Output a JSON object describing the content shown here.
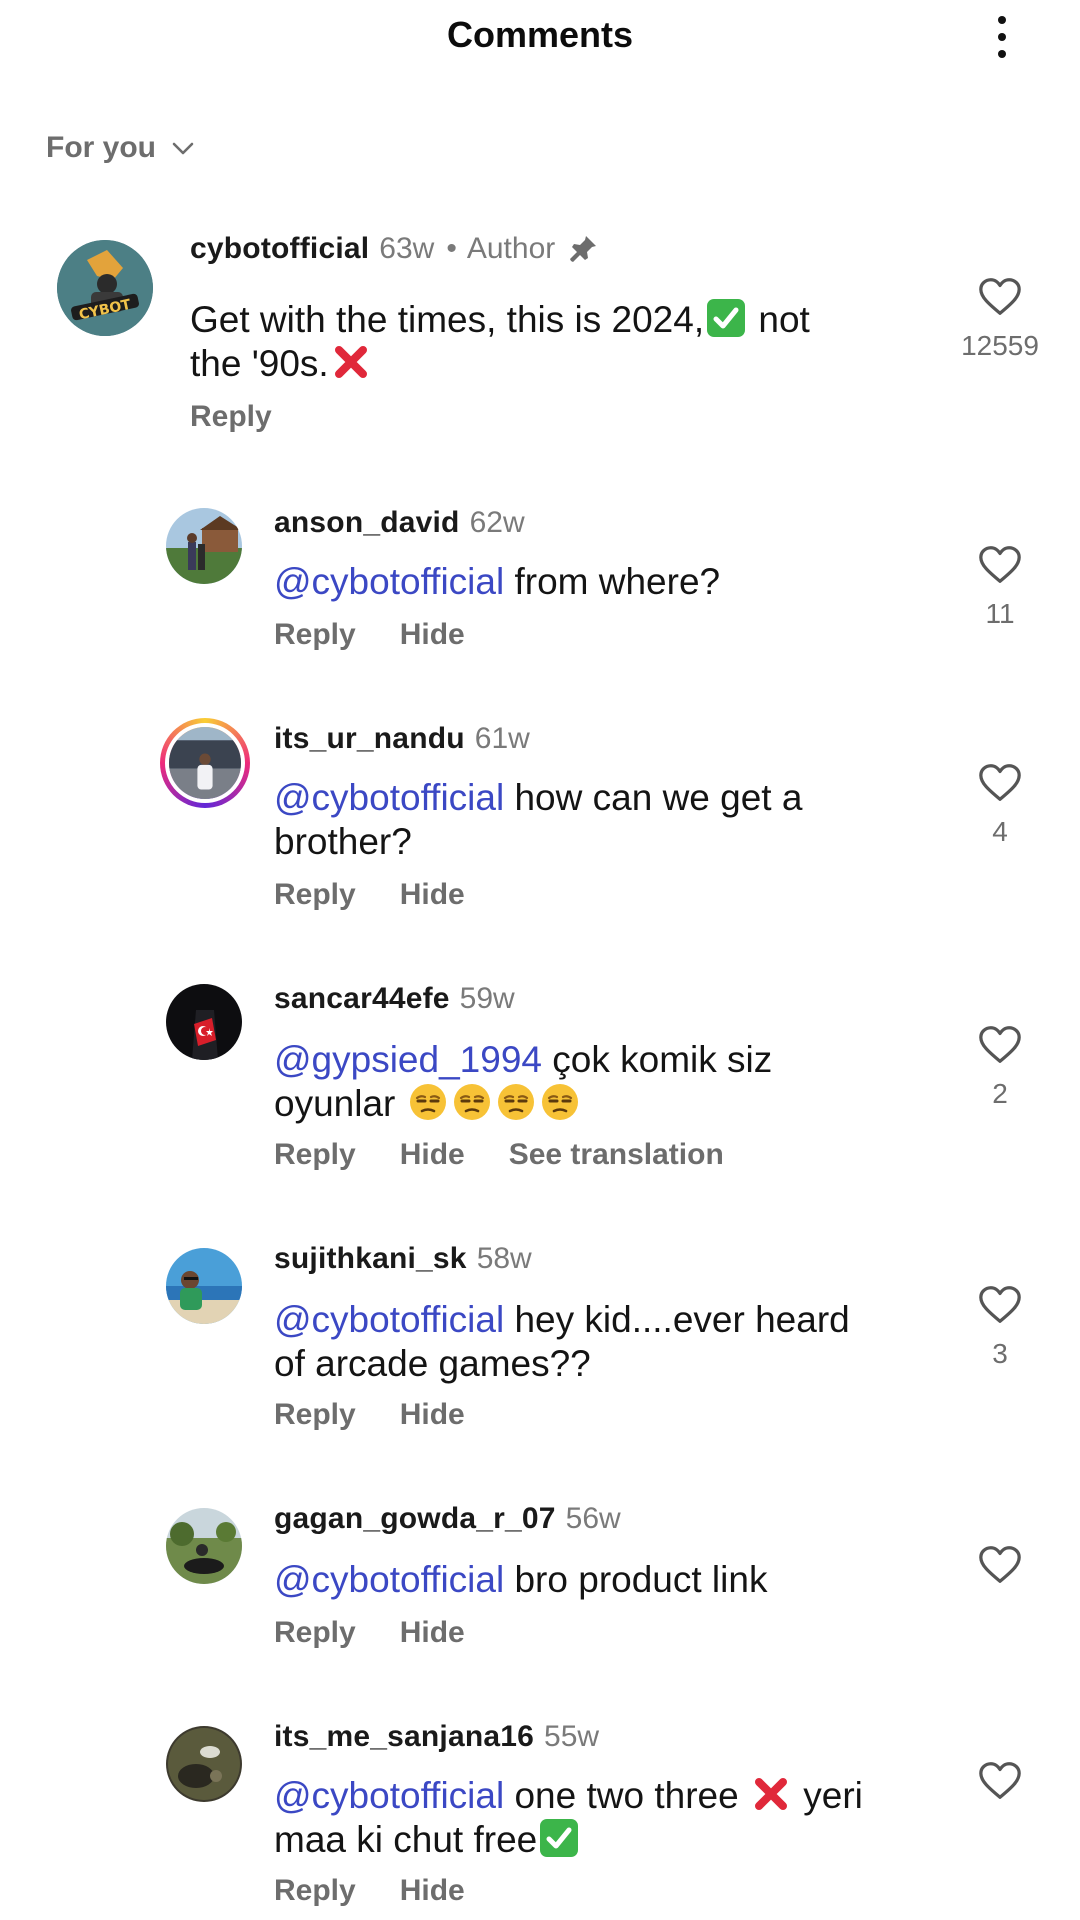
{
  "header": {
    "title": "Comments",
    "more_icon": "more-vertical-icon"
  },
  "sort": {
    "label": "For you",
    "icon": "chevron-down-icon"
  },
  "colors": {
    "mention": "#3b48c4",
    "muted": "#6d6d6d",
    "check_green": "#3cb54a",
    "cross_red": "#e0283a"
  },
  "comments": [
    {
      "username": "cybotofficial",
      "time": "63w",
      "author_label": "Author",
      "pinned": true,
      "text_part1": "Get with the times, this is 2024,",
      "text_part2": "not",
      "text_part3": "the '90s.",
      "reply_label": "Reply",
      "likes": "12559"
    },
    {
      "username": "anson_david",
      "time": "62w",
      "mention": "@cybotofficial",
      "text": "from where?",
      "reply_label": "Reply",
      "hide_label": "Hide",
      "likes": "11"
    },
    {
      "username": "its_ur_nandu",
      "time": "61w",
      "mention": "@cybotofficial",
      "text_line1": "how can we get a",
      "text_line2": "brother?",
      "reply_label": "Reply",
      "hide_label": "Hide",
      "likes": "4"
    },
    {
      "username": "sancar44efe",
      "time": "59w",
      "mention": "@gypsied_1994",
      "text_line1": "çok komik siz",
      "text_line2": "oyunlar",
      "reply_label": "Reply",
      "hide_label": "Hide",
      "translate_label": "See translation",
      "likes": "2"
    },
    {
      "username": "sujithkani_sk",
      "time": "58w",
      "mention": "@cybotofficial",
      "text_line1": "hey kid....ever heard",
      "text_line2": "of arcade games??",
      "reply_label": "Reply",
      "hide_label": "Hide",
      "likes": "3"
    },
    {
      "username": "gagan_gowda_r_07",
      "time": "56w",
      "mention": "@cybotofficial",
      "text": " bro product link",
      "reply_label": "Reply",
      "hide_label": "Hide",
      "likes": ""
    },
    {
      "username": "its_me_sanjana16",
      "time": "55w",
      "mention": "@cybotofficial",
      "text_line1a": "one two three",
      "text_line1b": "yeri",
      "text_line2": "maa ki chut free",
      "reply_label": "Reply",
      "hide_label": "Hide",
      "likes": ""
    }
  ]
}
